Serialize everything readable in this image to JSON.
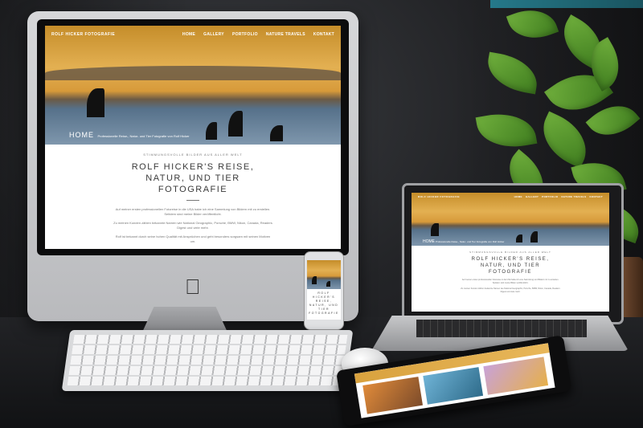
{
  "website": {
    "logo": "ROLF HICKER FOTOGRAFIE",
    "nav": [
      "HOME",
      "GALLERY",
      "PORTFOLIO",
      "NATURE TRAVELS",
      "KONTAKT"
    ],
    "hero_title": "HOME",
    "hero_subtitle": "Professionelle Reise-, Natur- und Tier Fotografie von Rolf Hicker",
    "kicker": "STIMMUNGSVOLLE BILDER AUS ALLER WELT",
    "headline": "ROLF HICKER'S REISE, NATUR, UND TIER FOTOGRAFIE",
    "paragraphs": [
      "Auf meiner ersten professionellen Fotoreise in die USA habe ich eine Sammlung von Bildern mit zu erstellen. Seitdem sind meine Bilder veröffentlicht.",
      "Zu meinen Kunden zählen bekannte Namen wie National Geographic, Porsche, BMW, Nikon, Canada, Readers Digest und viele mehr.",
      "Rolf ist bekannt durch seine hohen Qualität mit Ansprüchen und geht besonders sorgsam mit seinen Motiven um."
    ]
  },
  "colors": {
    "hero_sky": "#e3b052",
    "hero_water": "#7f97ad",
    "plant_green": "#5c9a2e",
    "desk": "#161719"
  },
  "objects": {
    "desktop": "imac",
    "laptop": "macbook",
    "phone": "iphone",
    "tablet": "tablet",
    "keyboard": "keyboard",
    "mouse": "mouse",
    "plant": "potted-plant",
    "logo": "apple-logo-icon"
  }
}
